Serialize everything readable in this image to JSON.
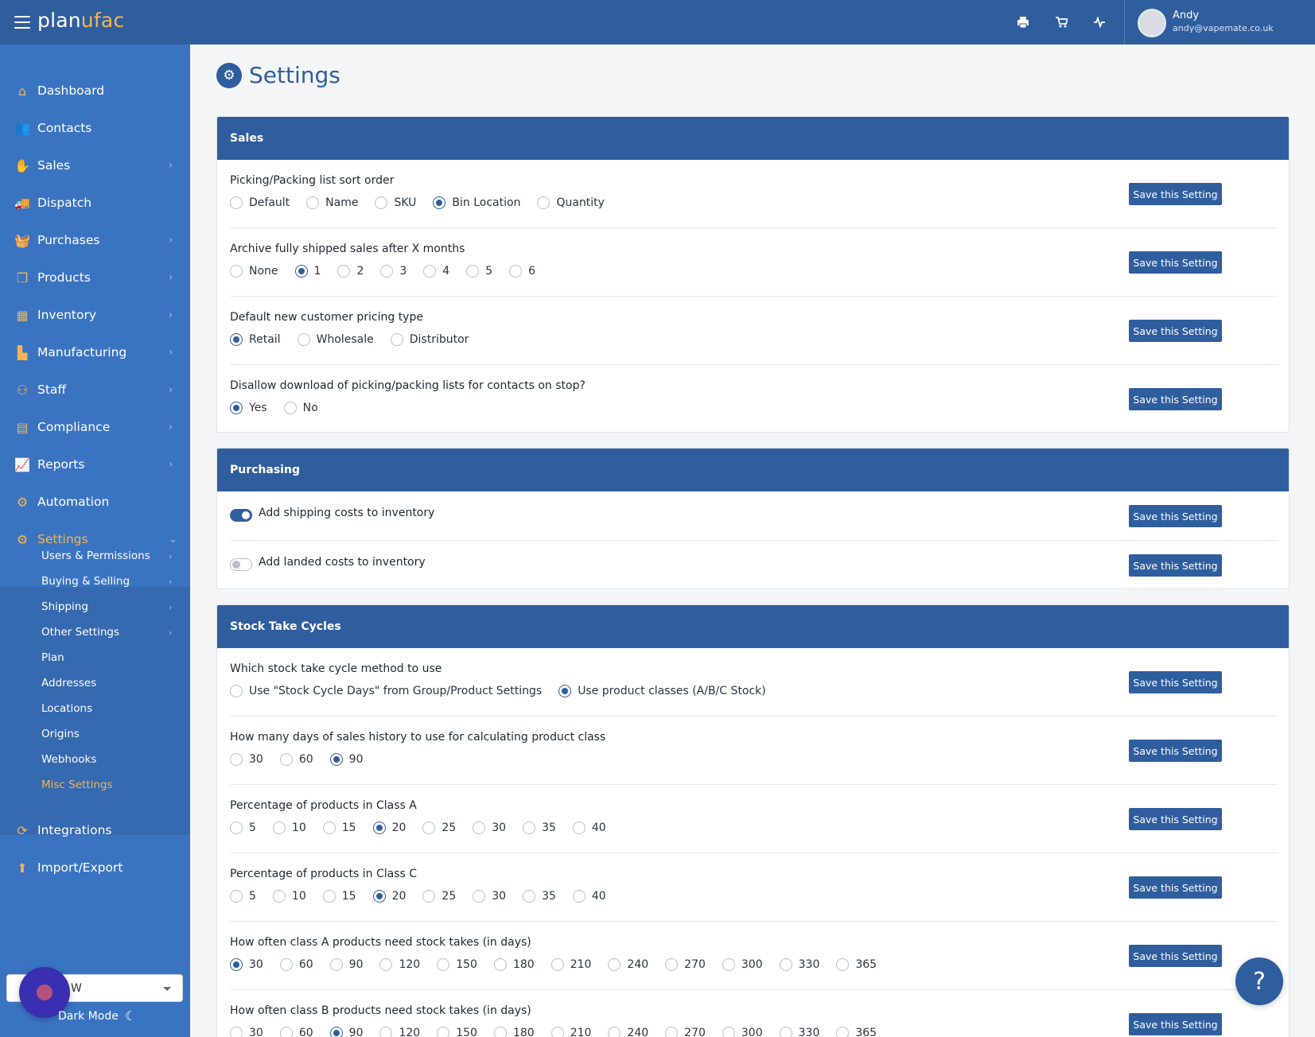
{
  "app": {
    "logo_prefix": "plan",
    "logo_suffix": "ufac",
    "user_name": "Andy",
    "user_email": "andy@vapemate.co.uk"
  },
  "topbar_icons": [
    "printer-icon",
    "cart-icon",
    "activity-icon"
  ],
  "sidebar": {
    "items": [
      {
        "label": "Dashboard",
        "icon": "home-icon",
        "chevron": false
      },
      {
        "label": "Contacts",
        "icon": "users-icon",
        "chevron": false
      },
      {
        "label": "Sales",
        "icon": "hand-coin-icon",
        "chevron": true
      },
      {
        "label": "Dispatch",
        "icon": "truck-icon",
        "chevron": false
      },
      {
        "label": "Purchases",
        "icon": "basket-icon",
        "chevron": true
      },
      {
        "label": "Products",
        "icon": "copy-icon",
        "chevron": true
      },
      {
        "label": "Inventory",
        "icon": "boxes-icon",
        "chevron": true
      },
      {
        "label": "Manufacturing",
        "icon": "factory-icon",
        "chevron": true
      },
      {
        "label": "Staff",
        "icon": "people-icon",
        "chevron": true
      },
      {
        "label": "Compliance",
        "icon": "clipboard-icon",
        "chevron": true
      },
      {
        "label": "Reports",
        "icon": "chart-icon",
        "chevron": true
      },
      {
        "label": "Automation",
        "icon": "robot-icon",
        "chevron": false
      },
      {
        "label": "Settings",
        "icon": "gear-icon",
        "chevron": true,
        "active": true
      },
      {
        "label": "Integrations",
        "icon": "sync-icon",
        "chevron": false
      },
      {
        "label": "Import/Export",
        "icon": "upload-icon",
        "chevron": false
      }
    ],
    "settings_submenu": [
      {
        "label": "Users & Permissions",
        "chevron": true
      },
      {
        "label": "Buying & Selling",
        "chevron": true
      },
      {
        "label": "Shipping",
        "chevron": true
      },
      {
        "label": "Other Settings",
        "chevron": true
      },
      {
        "label": "Plan",
        "chevron": false
      },
      {
        "label": "Addresses",
        "chevron": false
      },
      {
        "label": "Locations",
        "chevron": false
      },
      {
        "label": "Origins",
        "chevron": false
      },
      {
        "label": "Webhooks",
        "chevron": false
      },
      {
        "label": "Misc Settings",
        "chevron": false,
        "active": true
      }
    ],
    "language_value": "W",
    "dark_mode_label": "Dark Mode"
  },
  "page": {
    "title": "Settings",
    "save_label": "Save this Setting"
  },
  "sections": {
    "sales": {
      "title": "Sales",
      "rows": [
        {
          "title": "Picking/Packing list sort order",
          "options": [
            "Default",
            "Name",
            "SKU",
            "Bin Location",
            "Quantity"
          ],
          "selected": "Bin Location"
        },
        {
          "title": "Archive fully shipped sales after X months",
          "options": [
            "None",
            "1",
            "2",
            "3",
            "4",
            "5",
            "6"
          ],
          "selected": "1"
        },
        {
          "title": "Default new customer pricing type",
          "options": [
            "Retail",
            "Wholesale",
            "Distributor"
          ],
          "selected": "Retail"
        },
        {
          "title": "Disallow download of picking/packing lists for contacts on stop?",
          "options": [
            "Yes",
            "No"
          ],
          "selected": "Yes"
        }
      ]
    },
    "purchasing": {
      "title": "Purchasing",
      "toggles": [
        {
          "label": "Add shipping costs to inventory",
          "on": true
        },
        {
          "label": "Add landed costs to inventory",
          "on": false
        }
      ]
    },
    "stock": {
      "title": "Stock Take Cycles",
      "rows": [
        {
          "title": "Which stock take cycle method to use",
          "options": [
            "Use \"Stock Cycle Days\" from Group/Product Settings",
            "Use product classes (A/B/C Stock)"
          ],
          "selected": "Use product classes (A/B/C Stock)"
        },
        {
          "title": "How many days of sales history to use for calculating product class",
          "options": [
            "30",
            "60",
            "90"
          ],
          "selected": "90"
        },
        {
          "title": "Percentage of products in Class A",
          "options": [
            "5",
            "10",
            "15",
            "20",
            "25",
            "30",
            "35",
            "40"
          ],
          "selected": "20"
        },
        {
          "title": "Percentage of products in Class C",
          "options": [
            "5",
            "10",
            "15",
            "20",
            "25",
            "30",
            "35",
            "40"
          ],
          "selected": "20"
        },
        {
          "title": "How often class A products need stock takes (in days)",
          "options": [
            "30",
            "60",
            "90",
            "120",
            "150",
            "180",
            "210",
            "240",
            "270",
            "300",
            "330",
            "365"
          ],
          "selected": "30"
        },
        {
          "title": "How often class B products need stock takes (in days)",
          "options": [
            "30",
            "60",
            "90",
            "120",
            "150",
            "180",
            "210",
            "240",
            "270",
            "300",
            "330",
            "365"
          ],
          "selected": "90"
        }
      ]
    }
  },
  "help_label": "?"
}
